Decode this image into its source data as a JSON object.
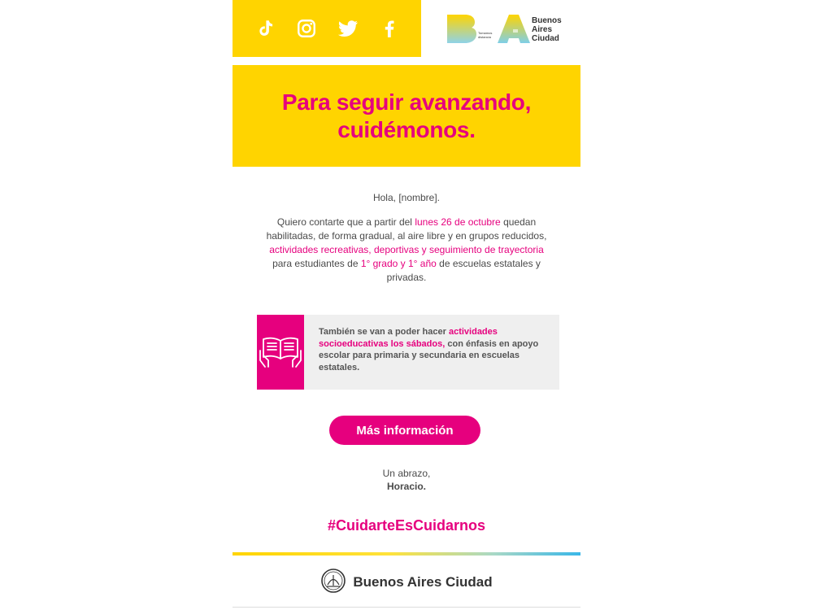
{
  "header": {
    "social_icons": [
      "tiktok-icon",
      "instagram-icon",
      "twitter-icon",
      "facebook-icon"
    ],
    "logo": {
      "small_text_line1": "Tomamos",
      "small_text_line2": "distancia",
      "brand_line1": "Buenos",
      "brand_line2": "Aires",
      "brand_line3": "Ciudad"
    }
  },
  "hero": {
    "line1": "Para seguir avanzando,",
    "line2": "cuidémonos."
  },
  "body": {
    "greeting": "Hola, [nombre].",
    "intro": {
      "t1": "Quiero contarte que a partir del ",
      "h1": "lunes 26 de octubre",
      "t2": " quedan habilitadas, de forma gradual, al aire libre y en grupos reducidos, ",
      "h2": "actividades recreativas, deportivas y seguimiento de trayectoria",
      "t3": " para estudiantes de ",
      "h3": "1° grado y 1° año",
      "t4": " de escuelas estatales y privadas."
    }
  },
  "card": {
    "icon": "book-icon",
    "t1": "También se van a poder hacer ",
    "h1": "actividades socioeducativas los sábados,",
    "t2": " con énfasis en apoyo escolar para primaria y secundaria en escuelas estatales."
  },
  "cta": {
    "label": "Más información"
  },
  "signoff": {
    "line1": "Un abrazo,",
    "name": "Horacio."
  },
  "hashtag": "#CuidarteEsCuidarnos",
  "footer": {
    "seal_icon": "city-seal-icon",
    "text": "Buenos Aires Ciudad"
  },
  "colors": {
    "yellow": "#ffd400",
    "magenta": "#e6007e",
    "card_bg": "#efefef"
  }
}
